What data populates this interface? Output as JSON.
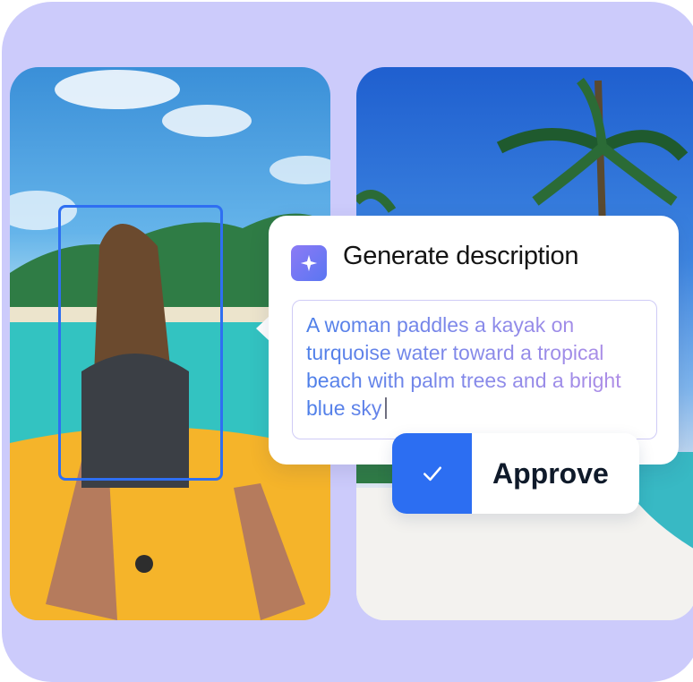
{
  "card": {
    "title": "Generate description",
    "description": "A woman paddles a kayak on turquoise water toward a tropical beach with palm trees and a bright blue sky",
    "sparkle_icon": "sparkle-icon"
  },
  "approve": {
    "label": "Approve",
    "icon": "check-icon"
  },
  "colors": {
    "frame": "#cccbfb",
    "accent": "#2c6ef2",
    "selection": "#2f6ff2"
  }
}
